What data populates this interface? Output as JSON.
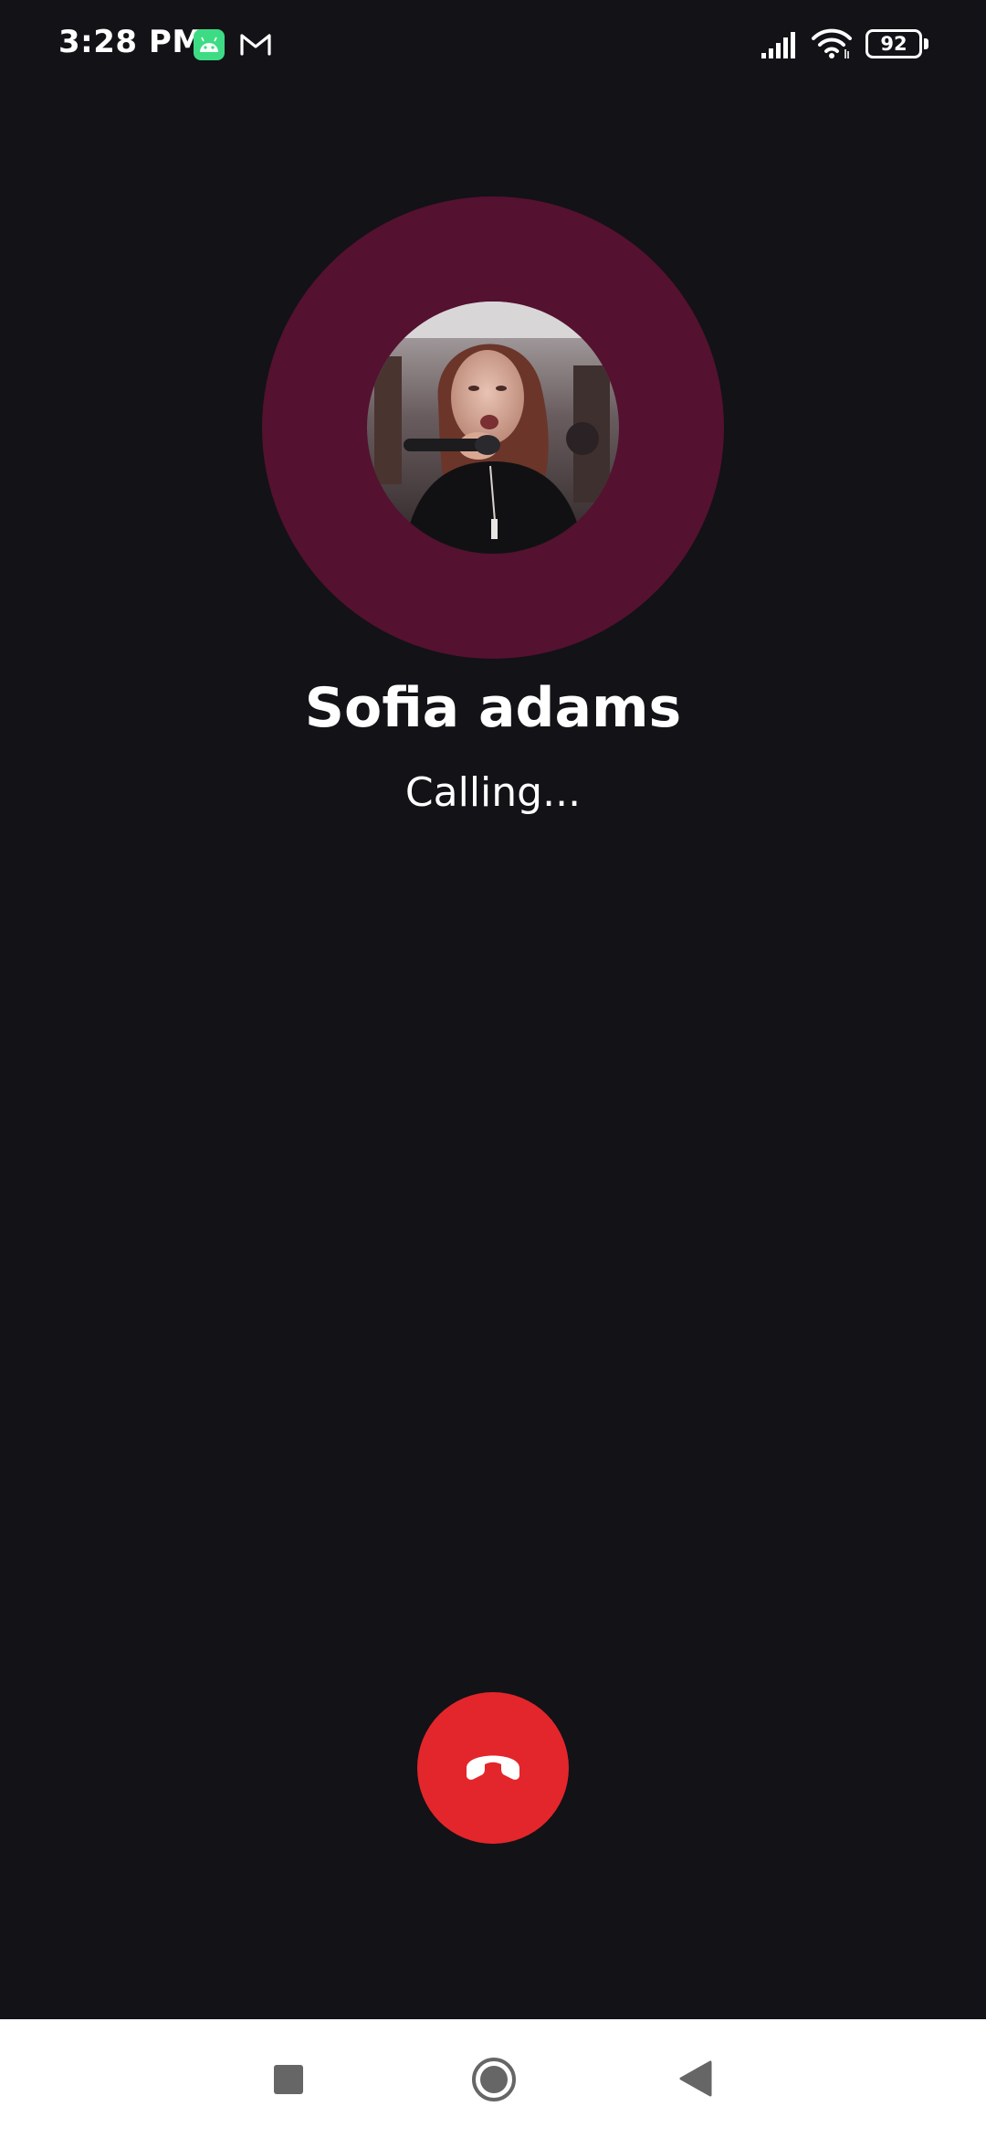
{
  "status_bar": {
    "time": "3:28 PM",
    "battery_level": "92",
    "icons": [
      "android-app-icon",
      "gmail-icon",
      "signal-icon",
      "wifi-icon",
      "battery-icon"
    ]
  },
  "call": {
    "caller_name": "Sofia adams",
    "status": "Calling..."
  },
  "colors": {
    "background": "#121217",
    "avatar_ring": "#541130",
    "end_call": "#e3262b",
    "nav_bar": "#ffffff"
  },
  "nav_bar": {
    "icons": [
      "recent-apps-icon",
      "home-icon",
      "back-icon"
    ]
  }
}
